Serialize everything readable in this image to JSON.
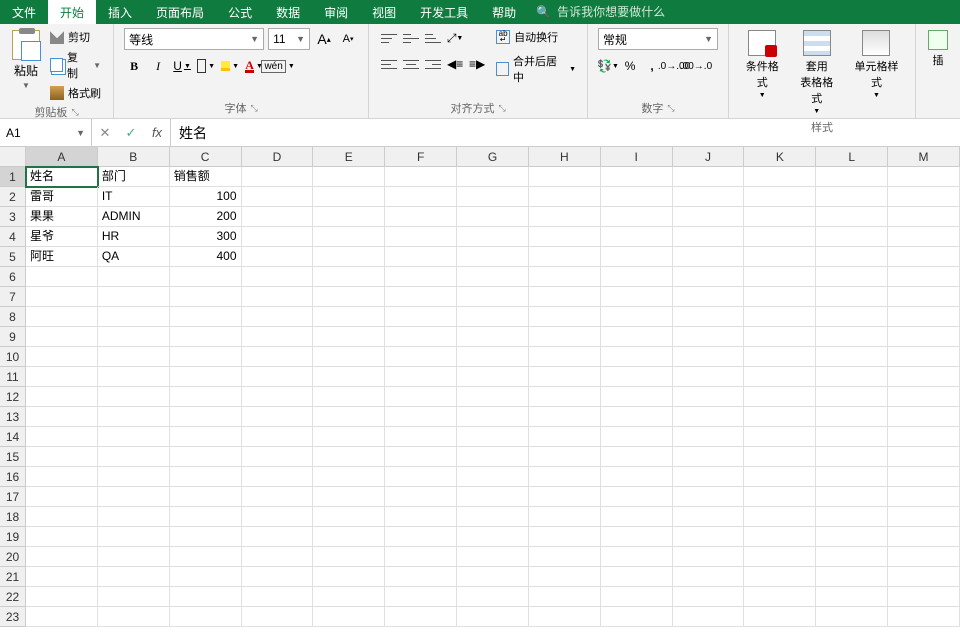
{
  "menu": {
    "items": [
      "文件",
      "开始",
      "插入",
      "页面布局",
      "公式",
      "数据",
      "审阅",
      "视图",
      "开发工具",
      "帮助"
    ],
    "active_index": 1,
    "search_placeholder": "告诉我你想要做什么"
  },
  "ribbon": {
    "clipboard": {
      "paste": "粘贴",
      "cut": "剪切",
      "copy": "复制",
      "format_painter": "格式刷",
      "label": "剪贴板"
    },
    "font": {
      "name": "等线",
      "size": "11",
      "label": "字体",
      "bold": "B",
      "italic": "I",
      "underline": "U",
      "bigger": "A",
      "smaller": "A",
      "wen": "wén",
      "colorA": "A"
    },
    "align": {
      "wrap": "自动换行",
      "merge": "合并后居中",
      "label": "对齐方式"
    },
    "number": {
      "format": "常规",
      "label": "数字"
    },
    "styles": {
      "cond": "条件格式",
      "table": "套用\n表格格式",
      "cell": "单元格样式",
      "label": "样式"
    },
    "insert_partial": "插"
  },
  "formula_bar": {
    "name_box": "A1",
    "formula": "姓名"
  },
  "grid": {
    "columns": [
      "A",
      "B",
      "C",
      "D",
      "E",
      "F",
      "G",
      "H",
      "I",
      "J",
      "K",
      "L",
      "M"
    ],
    "row_count": 23,
    "selected_cell": {
      "row": 1,
      "col": 0
    },
    "data": [
      {
        "r": 1,
        "c": 0,
        "v": "姓名"
      },
      {
        "r": 1,
        "c": 1,
        "v": "部门"
      },
      {
        "r": 1,
        "c": 2,
        "v": "销售额"
      },
      {
        "r": 2,
        "c": 0,
        "v": "雷哥"
      },
      {
        "r": 2,
        "c": 1,
        "v": "IT"
      },
      {
        "r": 2,
        "c": 2,
        "v": "100",
        "num": true
      },
      {
        "r": 3,
        "c": 0,
        "v": "果果"
      },
      {
        "r": 3,
        "c": 1,
        "v": "ADMIN"
      },
      {
        "r": 3,
        "c": 2,
        "v": "200",
        "num": true
      },
      {
        "r": 4,
        "c": 0,
        "v": "星爷"
      },
      {
        "r": 4,
        "c": 1,
        "v": "HR"
      },
      {
        "r": 4,
        "c": 2,
        "v": "300",
        "num": true
      },
      {
        "r": 5,
        "c": 0,
        "v": "阿旺"
      },
      {
        "r": 5,
        "c": 1,
        "v": "QA"
      },
      {
        "r": 5,
        "c": 2,
        "v": "400",
        "num": true
      }
    ]
  }
}
